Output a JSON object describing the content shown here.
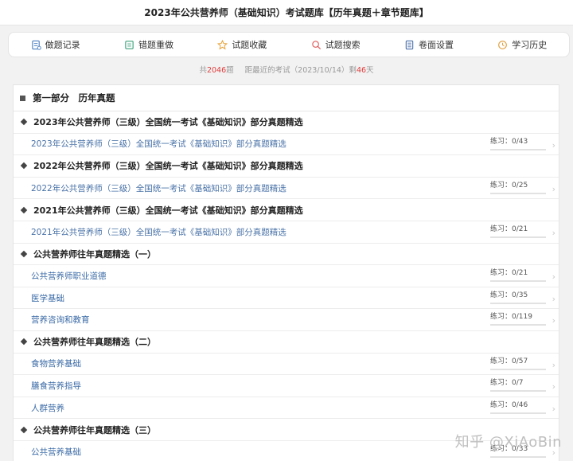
{
  "header": {
    "title": "2023年公共营养师（基础知识）考试题库【历年真题＋章节题库】"
  },
  "toolbar": [
    {
      "label": "做题记录",
      "icon": "record-icon"
    },
    {
      "label": "错题重做",
      "icon": "redo-icon"
    },
    {
      "label": "试题收藏",
      "icon": "star-icon"
    },
    {
      "label": "试题搜索",
      "icon": "search-icon"
    },
    {
      "label": "卷面设置",
      "icon": "settings-icon"
    },
    {
      "label": "学习历史",
      "icon": "history-icon"
    }
  ],
  "stats": {
    "total_prefix": "共",
    "total_count": "2046",
    "total_suffix": "题",
    "exam_prefix": "距最近的考试（2023/10/14）剩",
    "days": "46",
    "days_suffix": "天"
  },
  "part": {
    "title": "第一部分　历年真题"
  },
  "groups": [
    {
      "title": "2023年公共营养师（三级）全国统一考试《基础知识》部分真题精选",
      "items": [
        {
          "label": "2023年公共营养师（三级）全国统一考试《基础知识》部分真题精选",
          "progress": "练习：0/43",
          "done": 0
        }
      ]
    },
    {
      "title": "2022年公共营养师（三级）全国统一考试《基础知识》部分真题精选",
      "items": [
        {
          "label": "2022年公共营养师（三级）全国统一考试《基础知识》部分真题精选",
          "progress": "练习：0/25",
          "done": 0
        }
      ]
    },
    {
      "title": "2021年公共营养师（三级）全国统一考试《基础知识》部分真题精选",
      "items": [
        {
          "label": "2021年公共营养师（三级）全国统一考试《基础知识》部分真题精选",
          "progress": "练习：0/21",
          "done": 0
        }
      ]
    },
    {
      "title": "公共营养师往年真题精选（一）",
      "items": [
        {
          "label": "公共营养师职业道德",
          "progress": "练习：0/21",
          "done": 0
        },
        {
          "label": "医学基础",
          "progress": "练习：0/35",
          "done": 0
        },
        {
          "label": "营养咨询和教育",
          "progress": "练习：0/119",
          "done": 0
        }
      ]
    },
    {
      "title": "公共营养师往年真题精选（二）",
      "items": [
        {
          "label": "食物营养基础",
          "progress": "练习：0/57",
          "done": 0
        },
        {
          "label": "膳食营养指导",
          "progress": "练习：0/7",
          "done": 0
        },
        {
          "label": "人群营养",
          "progress": "练习：0/46",
          "done": 0
        }
      ]
    },
    {
      "title": "公共营养师往年真题精选（三）",
      "items": [
        {
          "label": "公共营养基础",
          "progress": "练习：0/33",
          "done": 0
        }
      ]
    }
  ],
  "watermark": "知乎 @XiAoBin",
  "colors": {
    "accent_red": "#e03c3c",
    "link_blue": "#4a73a8",
    "progress_blue": "#4a8ad4"
  }
}
